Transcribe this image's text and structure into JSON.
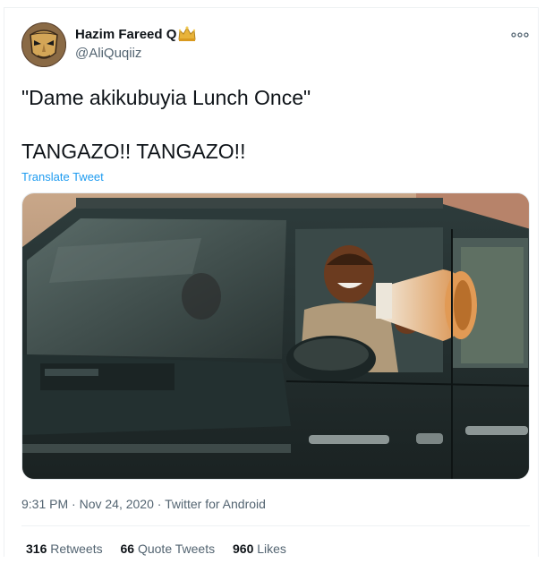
{
  "author": {
    "display_name": "Hazim Fareed Q",
    "handle": "@AliQuqiiz",
    "badge_icon": "crown-icon",
    "avatar_icon": "masked-avatar"
  },
  "tweet": {
    "line1": "\"Dame akikubuyia Lunch Once\"",
    "line2": "TANGAZO!! TANGAZO!!",
    "translate_label": "Translate Tweet"
  },
  "meta": {
    "time": "9:31 PM",
    "separator1": " · ",
    "date": "Nov 24, 2020",
    "separator2": " · ",
    "source": "Twitter for Android"
  },
  "stats": {
    "retweets_count": "316",
    "retweets_label": "Retweets",
    "quotes_count": "66",
    "quotes_label": "Quote Tweets",
    "likes_count": "960",
    "likes_label": "Likes"
  },
  "colors": {
    "link": "#1d9bf0",
    "secondary": "#536471",
    "primary": "#0f1419",
    "badge": "#e8b33a"
  }
}
